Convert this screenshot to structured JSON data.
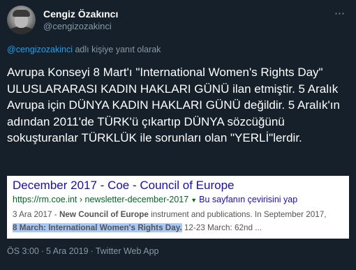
{
  "author": {
    "display_name": "Cengiz Özakıncı",
    "handle": "@cengizozakinci",
    "more_icon": "⋯"
  },
  "reply_context": {
    "handle": "@cengizozakinci",
    "suffix": " adlı kişiye yanıt olarak"
  },
  "tweet": {
    "text": "Avrupa Konseyi 8 Mart'ı \"International Women's Rights Day\" ULUSLARARASI KADIN HAKLARI GÜNÜ ilan etmiştir. 5 Aralık Avrupa için DÜNYA KADIN HAKLARI GÜNÜ değildir. 5 Aralık'ın adından 2011'de TÜRK'ü çıkartıp DÜNYA sözcüğünü sokuşturanlar TÜRKLÜK ile sorunları olan \"YERLİ\"lerdir."
  },
  "embed": {
    "title": "December 2017 - Coe - Council of Europe",
    "url": "https://rm.coe.int",
    "url_sep": " › ",
    "url_path": "newsletter-december-2017",
    "dropdown_icon": "▼",
    "translate_link": "Bu sayfanın çevirisini yap",
    "snippet": {
      "date": "3 Ara 2017",
      "dash": " - ",
      "bold1": "New Council of Europe",
      "text1": " instrument and publications. In September 2017,",
      "highlight_prefix": "8 March: ",
      "highlight_bold": "International Women's Rights Day.",
      "text2": " 12-23 March: 62nd ..."
    }
  },
  "meta": {
    "time": "ÖS 3:00",
    "date": "5 Ara 2019",
    "source": "Twitter Web App",
    "separator": "·"
  }
}
